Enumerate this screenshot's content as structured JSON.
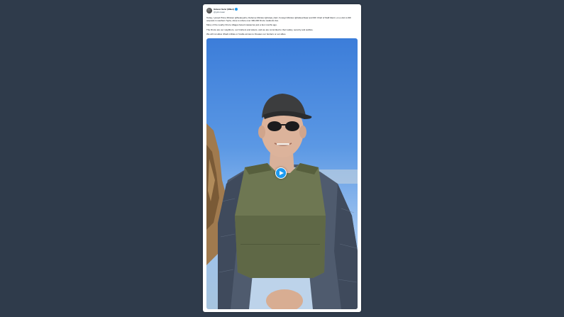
{
  "post": {
    "author_name": "Gideon Sa'ar (Mikel)",
    "author_handle": "@gidonsaar",
    "date": "",
    "paragraphs": [
      "Today, I joined Prime Minister @Netanyahu, Defense Minister @Israel_Katz, Foreign Minister @GideonSaar and IDF Chief of Staff Zamir, on a visit to IDF outposts in southern Syria, close to where over 300,000 Druze residents live.",
      "Many of the nearby Druze villages faced massacres just a few months ago.",
      "The Druze are our neighbors, our brothers and sisters, and we are committed to their safety, security and welfare.",
      "We will not allow Jihadi militias or hostile armies to threaten our borders or our allies."
    ]
  },
  "video": {
    "play_icon": "play-icon"
  },
  "colors": {
    "page_background": "#2f3b4b",
    "card_background": "#ffffff",
    "accent": "#1d9bf0"
  }
}
